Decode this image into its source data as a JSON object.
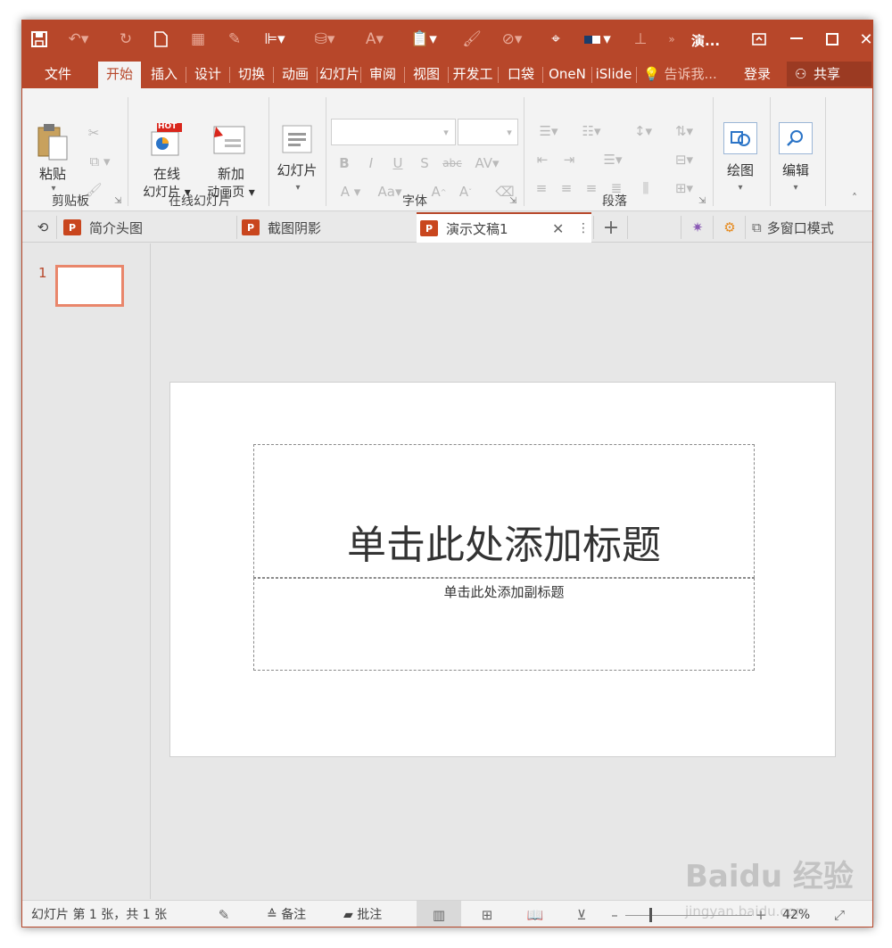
{
  "titlebar": {
    "doc_title_short": "演...",
    "qat_icons": [
      "save-icon",
      "undo-icon",
      "redo-icon",
      "new-icon",
      "grid-icon",
      "pen-icon",
      "align-icon",
      "bucket-icon",
      "font-color-icon",
      "paste-icon",
      "brush-icon",
      "shape-icon",
      "target-icon",
      "color-block-icon",
      "align-center-icon",
      "overflow-icon"
    ]
  },
  "ribbon_tabs": [
    "文件",
    "开始",
    "插入",
    "设计",
    "切换",
    "动画",
    "幻灯片",
    "审阅",
    "视图",
    "开发工",
    "口袋",
    "OneN",
    "iSlide"
  ],
  "tell_me": "告诉我...",
  "signin": "登录",
  "share": "共享",
  "ribbon": {
    "clipboard": {
      "paste": "粘贴",
      "label": "剪贴板"
    },
    "online": {
      "online_slides_l1": "在线",
      "online_slides_l2": "幻灯片 ▾",
      "new_anim_l1": "新加",
      "new_anim_l2": "动画页 ▾",
      "hot": "HOT",
      "label": "在线幻灯片"
    },
    "slides": {
      "label": "幻灯片"
    },
    "font": {
      "label": "字体"
    },
    "paragraph": {
      "label": "段落"
    },
    "drawing": {
      "label": "绘图"
    },
    "editing": {
      "label": "编辑"
    }
  },
  "doc_tabs": [
    {
      "label": "简介头图"
    },
    {
      "label": "截图阴影"
    },
    {
      "label": "演示文稿1"
    }
  ],
  "multiwindow": "多窗口模式",
  "thumbs": {
    "slide_number": "1"
  },
  "slide": {
    "title_placeholder": "单击此处添加标题",
    "subtitle_placeholder": "单击此处添加副标题"
  },
  "status": {
    "slide_info": "幻灯片 第 1 张，共 1 张",
    "notes": "备注",
    "comments": "批注",
    "zoom": "42%"
  },
  "watermark": {
    "line1": "Baidu 经验",
    "line2": "jingyan.baidu.com"
  },
  "colors": {
    "accent": "#b7472a",
    "tab_active_bg": "#f3f3f3",
    "thumb_border": "#e9866b"
  }
}
